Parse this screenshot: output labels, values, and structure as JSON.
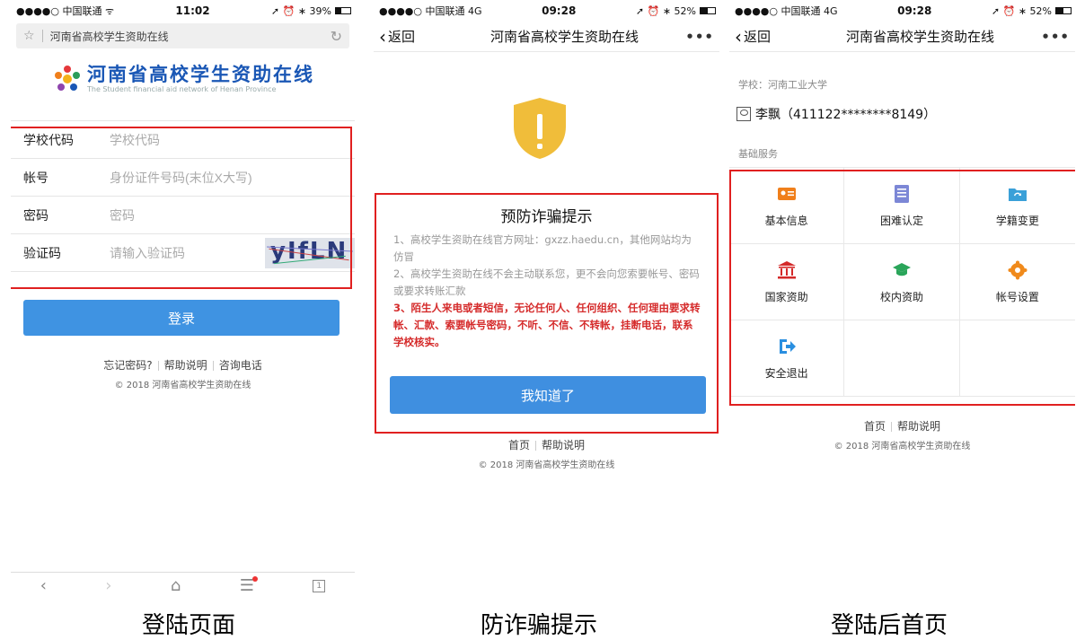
{
  "panel1": {
    "status": {
      "carrier": "●●●●○ 中国联通 ᯤ",
      "time": "11:02",
      "right": "➚ ⏰ ∗ 39%"
    },
    "address": "河南省高校学生资助在线",
    "logo": {
      "title": "河南省高校学生资助在线",
      "subtitle": "The Student financial aid network of Henan Province"
    },
    "form": {
      "school_label": "学校代码",
      "school_placeholder": "学校代码",
      "account_label": "帐号",
      "account_placeholder": "身份证件号码(末位X大写)",
      "password_label": "密码",
      "password_placeholder": "密码",
      "captcha_label": "验证码",
      "captcha_placeholder": "请输入验证码",
      "captcha_text": "yIfLN"
    },
    "login_button": "登录",
    "links": {
      "forgot": "忘记密码?",
      "help": "帮助说明",
      "phone": "咨询电话"
    },
    "copyright": "© 2018 河南省高校学生资助在线",
    "tabs_count": "1"
  },
  "panel2": {
    "status": {
      "carrier": "●●●●○ 中国联通 4G",
      "time": "09:28",
      "right": "➚ ⏰ ∗ 52%"
    },
    "nav": {
      "back": "返回",
      "title": "河南省高校学生资助在线",
      "more": "•••"
    },
    "alert": {
      "title": "预防诈骗提示",
      "line1": "1、高校学生资助在线官方网址：gxzz.haedu.cn，其他网站均为仿冒",
      "line2": "2、高校学生资助在线不会主动联系您，更不会向您索要帐号、密码或要求转账汇款",
      "line3": "3、陌生人来电或者短信，无论任何人、任何组织、任何理由要求转帐、汇款、索要帐号密码，不听、不信、不转帐，挂断电话，联系学校核实。"
    },
    "ok_button": "我知道了",
    "links": {
      "home": "首页",
      "help": "帮助说明"
    },
    "copyright": "© 2018 河南省高校学生资助在线"
  },
  "panel3": {
    "status": {
      "carrier": "●●●●○ 中国联通 4G",
      "time": "09:28",
      "right": "➚ ⏰ ∗ 52%"
    },
    "nav": {
      "back": "返回",
      "title": "河南省高校学生资助在线",
      "more": "•••"
    },
    "school": "学校：河南工业大学",
    "user": "李飘（411122********8149）",
    "services_title": "基础服务",
    "services": {
      "basic": "基本信息",
      "difficulty": "困难认定",
      "status_change": "学籍变更",
      "national": "国家资助",
      "campus": "校内资助",
      "account": "帐号设置",
      "logout": "安全退出"
    },
    "links": {
      "home": "首页",
      "help": "帮助说明"
    },
    "copyright": "© 2018 河南省高校学生资助在线"
  },
  "captions": {
    "c1": "登陆页面",
    "c2": "防诈骗提示",
    "c3": "登陆后首页"
  },
  "colors": {
    "primary": "#3f93e2",
    "alert_red": "#e02020",
    "logo_blue": "#1a57b5"
  }
}
